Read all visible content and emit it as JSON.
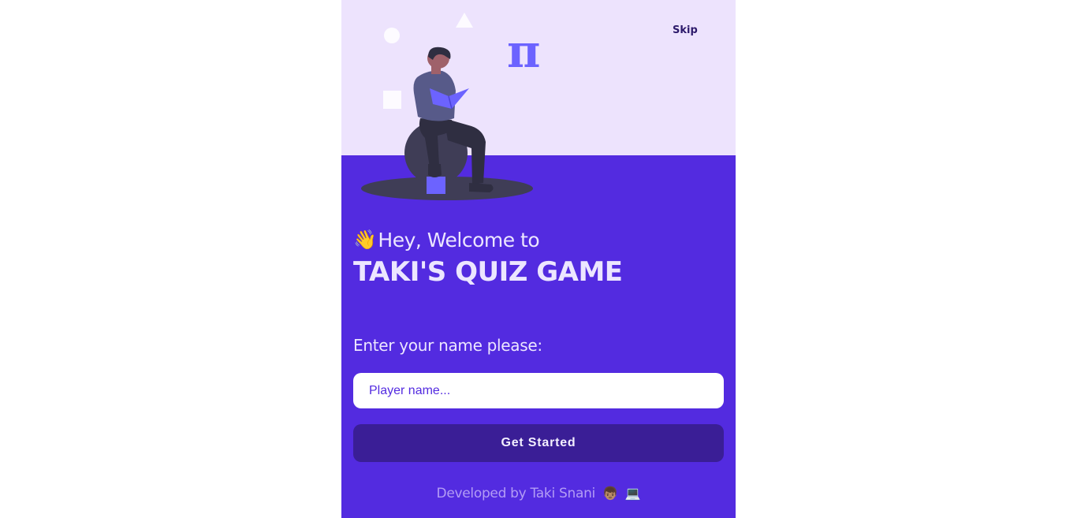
{
  "header": {
    "skip_label": "Skip",
    "pi_symbol": "π"
  },
  "welcome": {
    "wave_emoji": "👋",
    "greeting": "Hey, Welcome to",
    "title": "TAKI'S QUIZ GAME"
  },
  "form": {
    "name_label": "Enter your name please:",
    "name_placeholder": "Player name...",
    "name_value": "",
    "submit_label": "Get Started"
  },
  "footer": {
    "credit": "Developed by Taki Snani",
    "emoji_person": "👦🏽",
    "emoji_laptop": "💻"
  },
  "colors": {
    "primary": "#532be0",
    "hero_background": "#ede3fd",
    "button": "#3a1e96",
    "illustration_accent": "#6c63ff",
    "text_light": "#ece6ff"
  }
}
